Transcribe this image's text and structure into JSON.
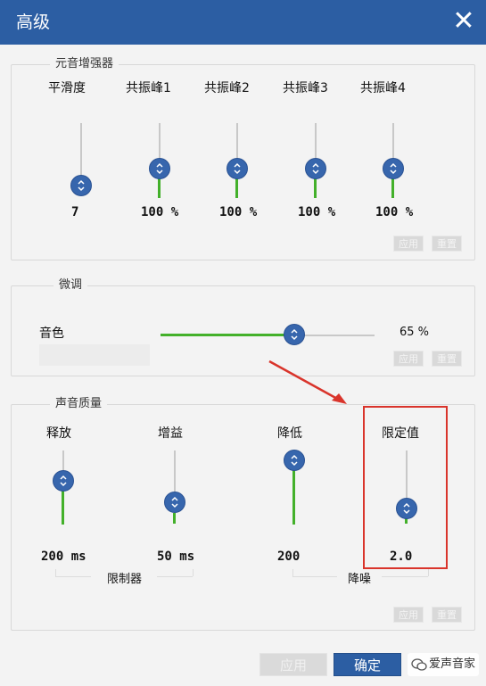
{
  "window": {
    "title": "高级"
  },
  "enhancer": {
    "title": "元音增强器",
    "sliders": [
      {
        "label": "平滑度",
        "value": "7",
        "level": 0.0
      },
      {
        "label": "共振峰1",
        "value": "100 %",
        "level": 0.5
      },
      {
        "label": "共振峰2",
        "value": "100 %",
        "level": 0.5
      },
      {
        "label": "共振峰3",
        "value": "100 %",
        "level": 0.5
      },
      {
        "label": "共振峰4",
        "value": "100 %",
        "level": 0.5
      }
    ],
    "apply_label": "应用",
    "reset_label": "重置"
  },
  "finetune": {
    "title": "微调",
    "timbre_label": "音色",
    "timbre_value": "65 %",
    "timbre_level": 0.65,
    "apply_label": "应用",
    "reset_label": "重置"
  },
  "quality": {
    "title": "声音质量",
    "sliders": [
      {
        "label": "释放",
        "value": "200 ms",
        "level": 0.5
      },
      {
        "label": "增益",
        "value": "50 ms",
        "level": 0.1
      },
      {
        "label": "降低",
        "value": "200",
        "level": 1.0
      },
      {
        "label": "限定值",
        "value": "2.0",
        "level": 0.1
      }
    ],
    "limiter_label": "限制器",
    "noise_label": "降噪",
    "apply_label": "应用",
    "reset_label": "重置"
  },
  "footer": {
    "apply_label": "应用",
    "ok_label": "确定"
  },
  "watermark": "爱声音家",
  "colors": {
    "title_bar": "#2c5ea3",
    "knob": "#3766ad",
    "slider_fill": "#43b02a",
    "highlight_box": "#d9342b"
  }
}
